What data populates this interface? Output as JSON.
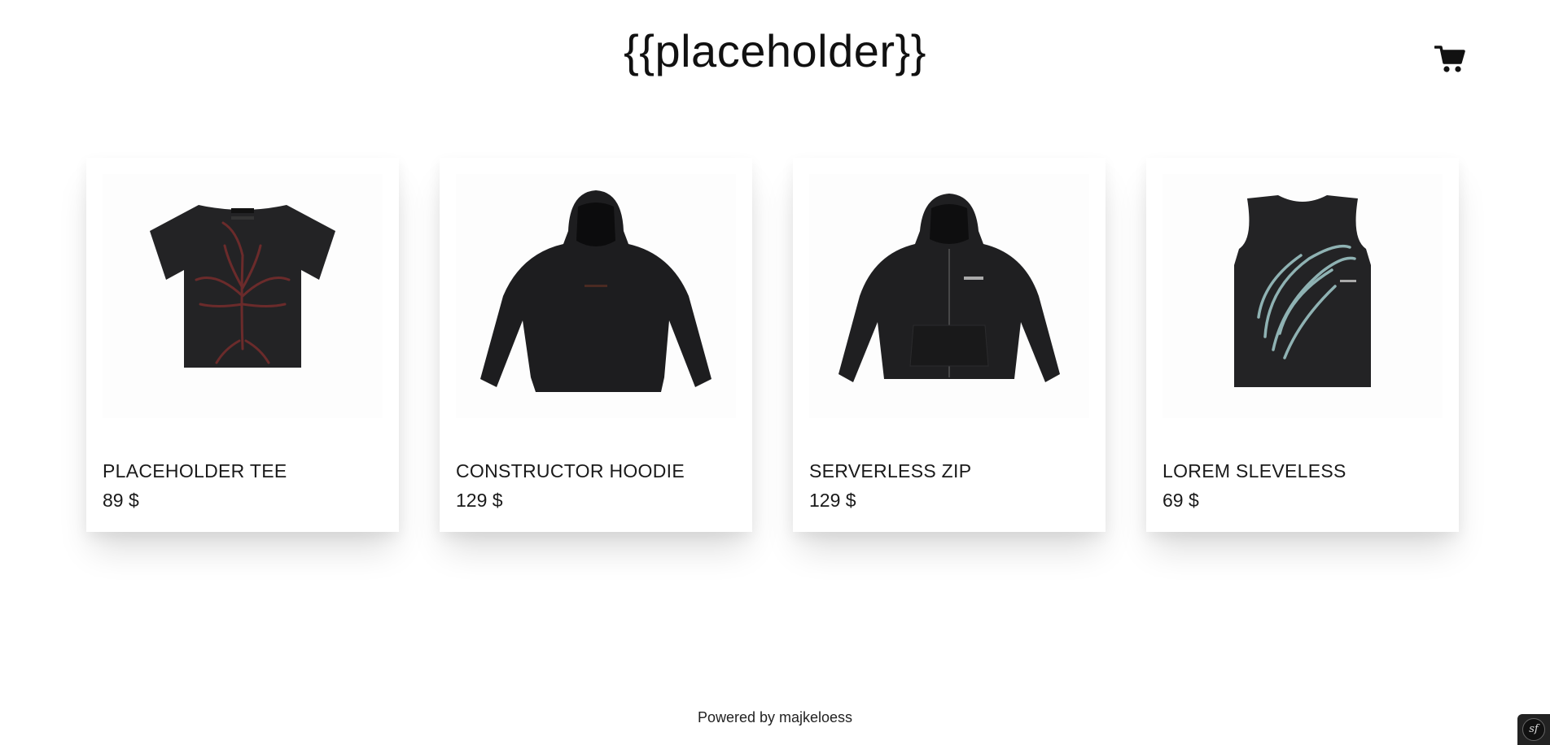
{
  "header": {
    "brand": "{{placeholder}}",
    "cart_icon": "shopping-cart-icon"
  },
  "products": [
    {
      "name": "PLACEHOLDER TEE",
      "price": "89 $",
      "image_icon": "black-tshirt-image"
    },
    {
      "name": "CONSTRUCTOR HOODIE",
      "price": "129 $",
      "image_icon": "black-hoodie-image"
    },
    {
      "name": "SERVERLESS ZIP",
      "price": "129 $",
      "image_icon": "black-zip-hoodie-image"
    },
    {
      "name": "LOREM SLEVELESS",
      "price": "69 $",
      "image_icon": "black-sleeveless-tank-image"
    }
  ],
  "footer": {
    "text": "Powered by majkeloess"
  },
  "debug_toolbar": {
    "icon": "symfony-logo-icon"
  }
}
